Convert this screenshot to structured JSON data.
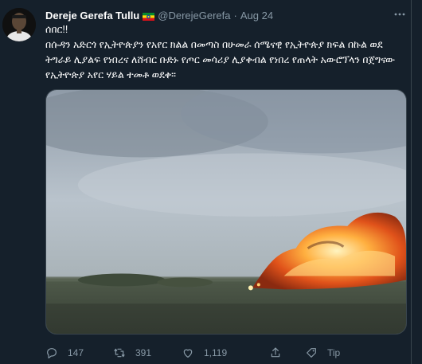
{
  "tweet": {
    "author_name": "Dereje Gerefa Tullu",
    "author_handle": "@DerejeGerefa",
    "separator": "·",
    "date": "Aug 24",
    "more_icon": "more-horizontal-icon",
    "lines": [
      "ሰበር!!",
      "በሱዳን አድርጎ የኢትዮጵያን የአየር ክልል በመጣስ በሁመራ ሰሜናዊ የኢትዮጵያ ክፍል በኩል ወደ ትግራይ ሊያልፍ የነበረና ለሸብር ቡድኑ የጦር መሳሪያ ሊያቀብል የነበረ የጠላት አውሮፕላን በጀግናው የኢትዮጵያ አየር ሃይል ተመቶ ወደቀ።"
    ],
    "media_alt": "video still of a burning aircraft crash in a field"
  },
  "actions": {
    "reply_count": "147",
    "retweet_count": "391",
    "like_count": "1,119",
    "tip_label": "Tip"
  },
  "colors": {
    "background": "#15202b",
    "secondary_text": "#8899a6",
    "border": "#38444d"
  }
}
